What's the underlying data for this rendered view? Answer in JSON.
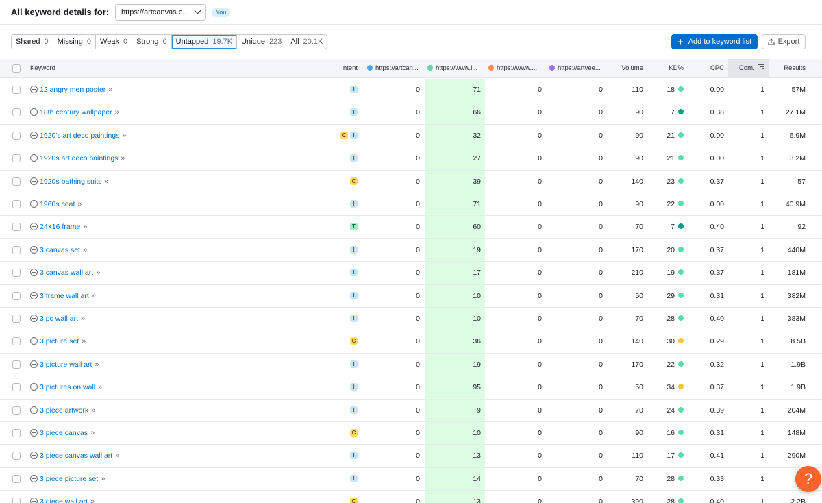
{
  "header": {
    "title": "All keyword details for:",
    "domain": "https://artcanvas.c...",
    "you_badge": "You"
  },
  "filters": [
    {
      "label": "Shared",
      "count": "0",
      "active": false
    },
    {
      "label": "Missing",
      "count": "0",
      "active": false
    },
    {
      "label": "Weak",
      "count": "0",
      "active": false
    },
    {
      "label": "Strong",
      "count": "0",
      "active": false
    },
    {
      "label": "Untapped",
      "count": "19.7K",
      "active": true
    },
    {
      "label": "Unique",
      "count": "223",
      "active": false
    },
    {
      "label": "All",
      "count": "20.1K",
      "active": false
    }
  ],
  "actions": {
    "add_label": "Add to keyword list",
    "export_label": "Export"
  },
  "columns": {
    "keyword": "Keyword",
    "intent": "Intent",
    "domain1": "https://artcan...",
    "domain2": "https://www.i...",
    "domain3": "https://www....",
    "domain4": "https://artvee...",
    "volume": "Volume",
    "kd": "KD%",
    "cpc": "CPC",
    "com": "Com.",
    "results": "Results"
  },
  "colors": {
    "domain1": "#4fa4f2",
    "domain2": "#5ed6a1",
    "domain3": "#ff8c52",
    "domain4": "#a66ce6",
    "kd_easy": "#59ddaa",
    "kd_very_easy": "#009f81",
    "kd_possible": "#fdc23c",
    "accent": "#006dca"
  },
  "rows": [
    {
      "keyword": "12 angry men poster",
      "intent": [
        "I"
      ],
      "d1": "0",
      "d2": "71",
      "d3": "0",
      "d4": "0",
      "volume": "110",
      "kd": "18",
      "kd_level": "easy",
      "cpc": "0.00",
      "com": "1",
      "results": "57M"
    },
    {
      "keyword": "18th century wallpaper",
      "intent": [
        "I"
      ],
      "d1": "0",
      "d2": "66",
      "d3": "0",
      "d4": "0",
      "volume": "90",
      "kd": "7",
      "kd_level": "very_easy",
      "cpc": "0.38",
      "com": "1",
      "results": "27.1M"
    },
    {
      "keyword": "1920's art deco paintings",
      "intent": [
        "C",
        "I"
      ],
      "d1": "0",
      "d2": "32",
      "d3": "0",
      "d4": "0",
      "volume": "90",
      "kd": "21",
      "kd_level": "easy",
      "cpc": "0.00",
      "com": "1",
      "results": "6.9M"
    },
    {
      "keyword": "1920s art deco paintings",
      "intent": [
        "I"
      ],
      "d1": "0",
      "d2": "27",
      "d3": "0",
      "d4": "0",
      "volume": "90",
      "kd": "21",
      "kd_level": "easy",
      "cpc": "0.00",
      "com": "1",
      "results": "3.2M"
    },
    {
      "keyword": "1920s bathing suits",
      "intent": [
        "C"
      ],
      "d1": "0",
      "d2": "39",
      "d3": "0",
      "d4": "0",
      "volume": "140",
      "kd": "23",
      "kd_level": "easy",
      "cpc": "0.37",
      "com": "1",
      "results": "57"
    },
    {
      "keyword": "1960s coat",
      "intent": [
        "I"
      ],
      "d1": "0",
      "d2": "71",
      "d3": "0",
      "d4": "0",
      "volume": "90",
      "kd": "22",
      "kd_level": "easy",
      "cpc": "0.00",
      "com": "1",
      "results": "40.9M"
    },
    {
      "keyword": "24×16 frame",
      "intent": [
        "T"
      ],
      "d1": "0",
      "d2": "60",
      "d3": "0",
      "d4": "0",
      "volume": "70",
      "kd": "7",
      "kd_level": "very_easy",
      "cpc": "0.40",
      "com": "1",
      "results": "92"
    },
    {
      "keyword": "3 canvas set",
      "intent": [
        "I"
      ],
      "d1": "0",
      "d2": "19",
      "d3": "0",
      "d4": "0",
      "volume": "170",
      "kd": "20",
      "kd_level": "easy",
      "cpc": "0.37",
      "com": "1",
      "results": "440M"
    },
    {
      "keyword": "3 canvas wall art",
      "intent": [
        "I"
      ],
      "d1": "0",
      "d2": "17",
      "d3": "0",
      "d4": "0",
      "volume": "210",
      "kd": "19",
      "kd_level": "easy",
      "cpc": "0.37",
      "com": "1",
      "results": "181M"
    },
    {
      "keyword": "3 frame wall art",
      "intent": [
        "I"
      ],
      "d1": "0",
      "d2": "10",
      "d3": "0",
      "d4": "0",
      "volume": "50",
      "kd": "29",
      "kd_level": "easy",
      "cpc": "0.31",
      "com": "1",
      "results": "382M"
    },
    {
      "keyword": "3 pc wall art",
      "intent": [
        "I"
      ],
      "d1": "0",
      "d2": "10",
      "d3": "0",
      "d4": "0",
      "volume": "70",
      "kd": "28",
      "kd_level": "easy",
      "cpc": "0.40",
      "com": "1",
      "results": "383M"
    },
    {
      "keyword": "3 picture set",
      "intent": [
        "C"
      ],
      "d1": "0",
      "d2": "36",
      "d3": "0",
      "d4": "0",
      "volume": "140",
      "kd": "30",
      "kd_level": "possible",
      "cpc": "0.29",
      "com": "1",
      "results": "8.5B"
    },
    {
      "keyword": "3 picture wall art",
      "intent": [
        "I"
      ],
      "d1": "0",
      "d2": "19",
      "d3": "0",
      "d4": "0",
      "volume": "170",
      "kd": "22",
      "kd_level": "easy",
      "cpc": "0.32",
      "com": "1",
      "results": "1.9B"
    },
    {
      "keyword": "3 pictures on wall",
      "intent": [
        "I"
      ],
      "d1": "0",
      "d2": "95",
      "d3": "0",
      "d4": "0",
      "volume": "50",
      "kd": "34",
      "kd_level": "possible",
      "cpc": "0.37",
      "com": "1",
      "results": "1.9B"
    },
    {
      "keyword": "3 piece artwork",
      "intent": [
        "I"
      ],
      "d1": "0",
      "d2": "9",
      "d3": "0",
      "d4": "0",
      "volume": "70",
      "kd": "24",
      "kd_level": "easy",
      "cpc": "0.39",
      "com": "1",
      "results": "204M"
    },
    {
      "keyword": "3 piece canvas",
      "intent": [
        "C"
      ],
      "d1": "0",
      "d2": "10",
      "d3": "0",
      "d4": "0",
      "volume": "90",
      "kd": "16",
      "kd_level": "easy",
      "cpc": "0.31",
      "com": "1",
      "results": "148M"
    },
    {
      "keyword": "3 piece canvas wall art",
      "intent": [
        "I"
      ],
      "d1": "0",
      "d2": "13",
      "d3": "0",
      "d4": "0",
      "volume": "110",
      "kd": "17",
      "kd_level": "easy",
      "cpc": "0.41",
      "com": "1",
      "results": "290M"
    },
    {
      "keyword": "3 piece picture set",
      "intent": [
        "I"
      ],
      "d1": "0",
      "d2": "14",
      "d3": "0",
      "d4": "0",
      "volume": "70",
      "kd": "28",
      "kd_level": "easy",
      "cpc": "0.33",
      "com": "1",
      "results": "7"
    },
    {
      "keyword": "3 piece wall art",
      "intent": [
        "C"
      ],
      "d1": "0",
      "d2": "13",
      "d3": "0",
      "d4": "0",
      "volume": "390",
      "kd": "28",
      "kd_level": "easy",
      "cpc": "0.40",
      "com": "1",
      "results": "2.2B"
    }
  ],
  "help": {
    "label": "?"
  }
}
